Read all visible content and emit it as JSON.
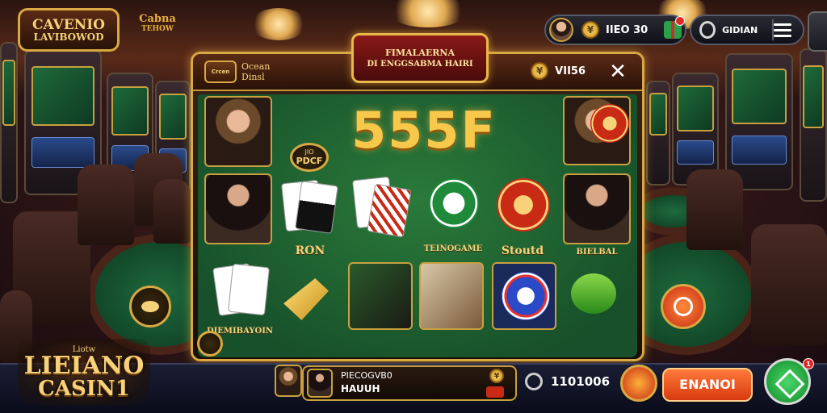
{
  "top_left_logo": {
    "line1": "CAVENIO",
    "line2": "LAVIBOWOD",
    "line3": ""
  },
  "top_sub_logo": {
    "line1": "",
    "line2": "Cabna",
    "line3": "TEHOW"
  },
  "top_bar": {
    "balance": "IIEO 30",
    "coin_symbol": "¥",
    "user_label": "GIDIAN",
    "notification_count": ""
  },
  "panel": {
    "header_logo": "Crcen",
    "header_subtitle_1": "Ocean",
    "header_subtitle_2": "Dinsl",
    "title_line1": "FIMALAERNA",
    "title_line2": "DI ENGGSABMA HAIRI",
    "coin_symbol": "¥",
    "header_value": "VII56",
    "close": "✕",
    "big_number": "555F",
    "badge_top": "JIO",
    "badge_bottom": "PDCF",
    "labels": {
      "poker": "RON",
      "casino": "TEINOGAME",
      "slots": "Stoutd",
      "live": "BIELBAL",
      "bottom_left": "DIEMIBAYOIN"
    }
  },
  "bottom_left_logo": {
    "line1": "Liotw",
    "line2": "LIEIANO",
    "line3": "CASIN1"
  },
  "bottom_bar": {
    "info_line1": "PIECOGVB0",
    "info_line2": "HAUUH",
    "info_coin": "¥",
    "coin_count": "1101006",
    "orange_button": "ENANOI",
    "notification_count": "1"
  }
}
